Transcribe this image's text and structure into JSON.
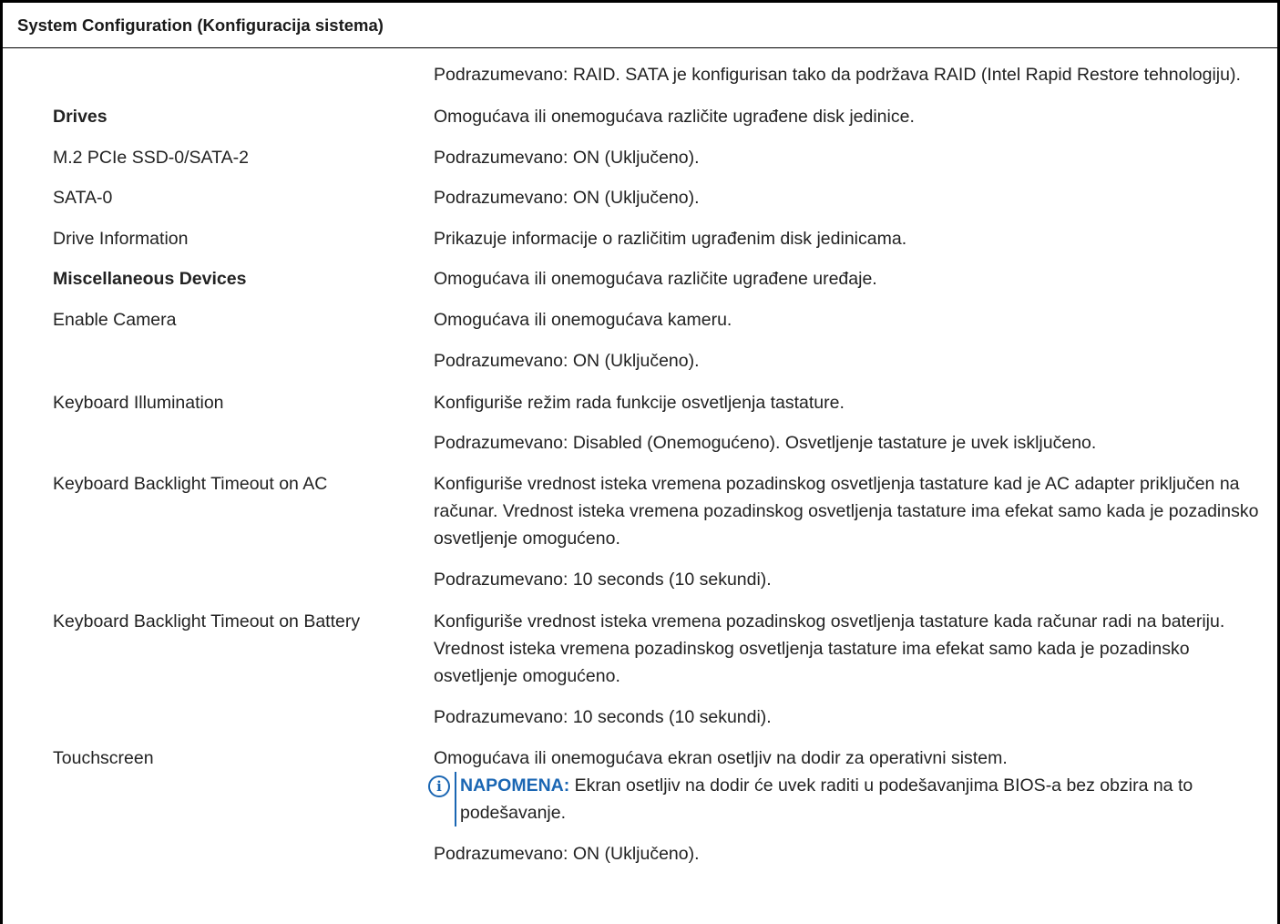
{
  "header": {
    "title": "System Configuration (Konfiguracija sistema)"
  },
  "rows": [
    {
      "label": "",
      "bold": false,
      "text": "Podrazumevano: RAID. SATA je konfigurisan tako da podržava RAID (Intel Rapid Restore tehnologiju)."
    },
    {
      "label": "Drives",
      "bold": true,
      "text": "Omogućava ili onemogućava različite ugrađene disk jedinice."
    },
    {
      "label": "M.2 PCIe SSD-0/SATA-2",
      "bold": false,
      "text": "Podrazumevano: ON (Uključeno)."
    },
    {
      "label": "SATA-0",
      "bold": false,
      "text": "Podrazumevano: ON (Uključeno)."
    },
    {
      "label": "Drive Information",
      "bold": false,
      "text": "Prikazuje informacije o različitim ugrađenim disk jedinicama."
    },
    {
      "label": "Miscellaneous Devices",
      "bold": true,
      "text": "Omogućava ili onemogućava različite ugrađene uređaje."
    },
    {
      "label": "Enable Camera",
      "bold": false,
      "text": "Omogućava ili onemogućava kameru."
    },
    {
      "label": "",
      "bold": false,
      "text": "Podrazumevano: ON (Uključeno)."
    },
    {
      "label": "Keyboard Illumination",
      "bold": false,
      "text": "Konfiguriše režim rada funkcije osvetljenja tastature."
    },
    {
      "label": "",
      "bold": false,
      "text": "Podrazumevano: Disabled (Onemogućeno). Osvetljenje tastature je uvek isključeno."
    },
    {
      "label": "Keyboard Backlight Timeout on AC",
      "bold": false,
      "text": "Konfiguriše vrednost isteka vremena pozadinskog osvetljenja tastature kad je AC adapter priključen na računar. Vrednost isteka vremena pozadinskog osvetljenja tastature ima efekat samo kada je pozadinsko osvetljenje omogućeno."
    },
    {
      "label": "",
      "bold": false,
      "text": "Podrazumevano: 10 seconds (10 sekundi)."
    },
    {
      "label": "Keyboard Backlight Timeout on Battery",
      "bold": false,
      "text": "Konfiguriše vrednost isteka vremena pozadinskog osvetljenja tastature kada računar radi na bateriju. Vrednost isteka vremena pozadinskog osvetljenja tastature ima efekat samo kada je pozadinsko osvetljenje omogućeno."
    },
    {
      "label": "",
      "bold": false,
      "text": "Podrazumevano: 10 seconds (10 sekundi)."
    },
    {
      "label": "Touchscreen",
      "bold": false,
      "text": "Omogućava ili onemogućava ekran osetljiv na dodir za operativni sistem."
    },
    {
      "label": "",
      "bold": false,
      "text": "Podrazumevano: ON (Uključeno)."
    }
  ],
  "note": {
    "icon": "info-icon",
    "label": "NAPOMENA:",
    "text": "Ekran osetljiv na dodir će uvek raditi u podešavanjima BIOS-a bez obzira na to podešavanje."
  },
  "colors": {
    "accent": "#1a66b3",
    "border": "#000000",
    "text": "#222222"
  }
}
